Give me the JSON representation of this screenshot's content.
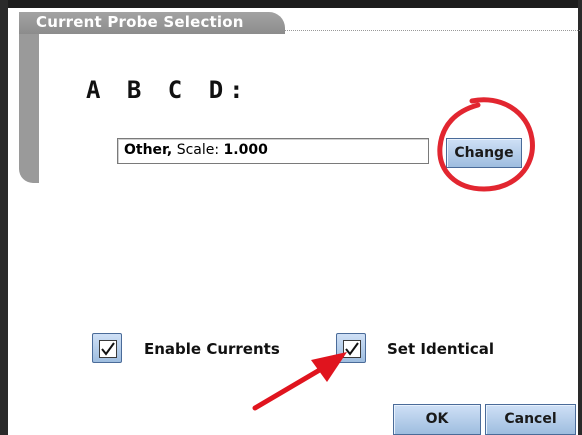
{
  "dialog": {
    "title": "Current Probe Selection",
    "channels_label": "A B C D:"
  },
  "probe": {
    "type": "Other,",
    "scale_label": "Scale:",
    "scale_value": "1.000"
  },
  "buttons": {
    "change": "Change",
    "ok": "OK",
    "cancel": "Cancel"
  },
  "options": {
    "enable_currents": {
      "label": "Enable Currents",
      "checked": true
    },
    "set_identical": {
      "label": "Set Identical",
      "checked": true
    }
  },
  "annotations": {
    "circle_color": "#e0141e",
    "arrow_color": "#e0141e"
  },
  "colors": {
    "button_fill": "#b3cdea",
    "header_tab": "#999999"
  }
}
